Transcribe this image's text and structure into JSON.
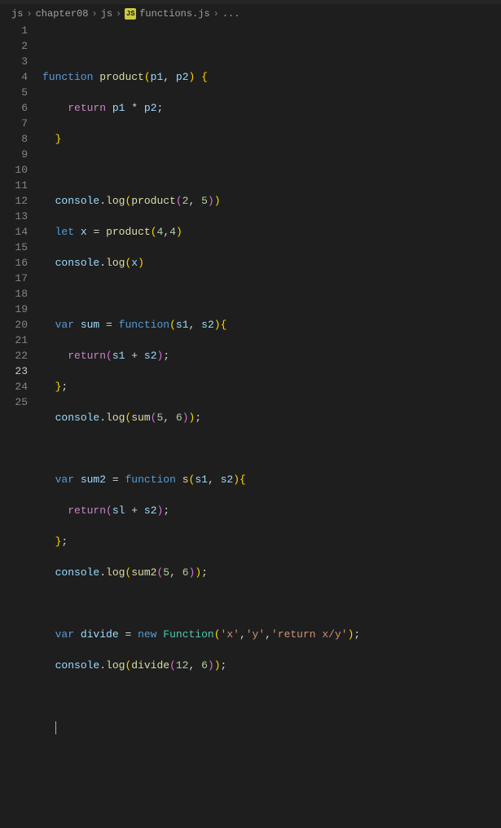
{
  "breadcrumbs": {
    "p1": "js",
    "p2": "chapter08",
    "p3": "js",
    "file": "functions.js",
    "tail": "..."
  },
  "icons": {
    "js_label": "JS"
  },
  "lines": {
    "l1": "",
    "l2_kw": "function",
    "l2_fn": "product",
    "l2_p1": "p1",
    "l2_p2": "p2",
    "l3_kw": "return",
    "l3_v1": "p1",
    "l3_v2": "p2",
    "l6_obj": "console",
    "l6_m": "log",
    "l6_fn": "product",
    "l6_a": "2",
    "l6_b": "5",
    "l7_kw": "let",
    "l7_v": "x",
    "l7_fn": "product",
    "l7_a": "4",
    "l7_b": "4",
    "l8_obj": "console",
    "l8_m": "log",
    "l8_v": "x",
    "l10_kw": "var",
    "l10_v": "sum",
    "l10_kw2": "function",
    "l10_p1": "s1",
    "l10_p2": "s2",
    "l11_kw": "return",
    "l11_v1": "s1",
    "l11_v2": "s2",
    "l13_obj": "console",
    "l13_m": "log",
    "l13_fn": "sum",
    "l13_a": "5",
    "l13_b": "6",
    "l15_kw": "var",
    "l15_v": "sum2",
    "l15_kw2": "function",
    "l15_fn": "s",
    "l15_p1": "s1",
    "l15_p2": "s2",
    "l16_kw": "return",
    "l16_v1": "sl",
    "l16_v2": "s2",
    "l18_obj": "console",
    "l18_m": "log",
    "l18_fn": "sum2",
    "l18_a": "5",
    "l18_b": "6",
    "l20_kw": "var",
    "l20_v": "divide",
    "l20_kw2": "new",
    "l20_cls": "Function",
    "l20_s1": "'x'",
    "l20_s2": "'y'",
    "l20_s3": "'return x/y'",
    "l21_obj": "console",
    "l21_m": "log",
    "l21_fn": "divide",
    "l21_a": "12",
    "l21_b": "6"
  },
  "line_numbers": [
    "1",
    "2",
    "3",
    "4",
    "5",
    "6",
    "7",
    "8",
    "9",
    "10",
    "11",
    "12",
    "13",
    "14",
    "15",
    "16",
    "17",
    "18",
    "19",
    "20",
    "21",
    "22",
    "23",
    "24",
    "25"
  ]
}
